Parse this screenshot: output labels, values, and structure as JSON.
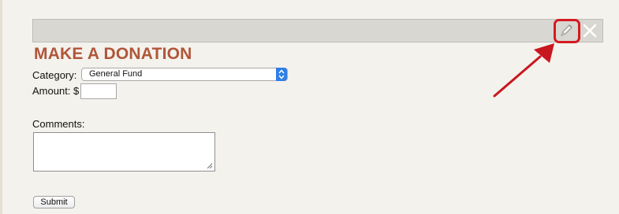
{
  "toolbar": {
    "edit_icon": "pencil-icon",
    "close_icon": "close-icon"
  },
  "form": {
    "title": "MAKE A DONATION",
    "category_label": "Category:",
    "category_value": "General Fund",
    "amount_label": "Amount: $",
    "amount_value": "",
    "comments_label": "Comments:",
    "comments_value": "",
    "submit_label": "Submit"
  },
  "colors": {
    "title": "#b0563a",
    "highlight": "#d51a22",
    "select_accent": "#2f7fe6",
    "background": "#f4f2ec"
  }
}
